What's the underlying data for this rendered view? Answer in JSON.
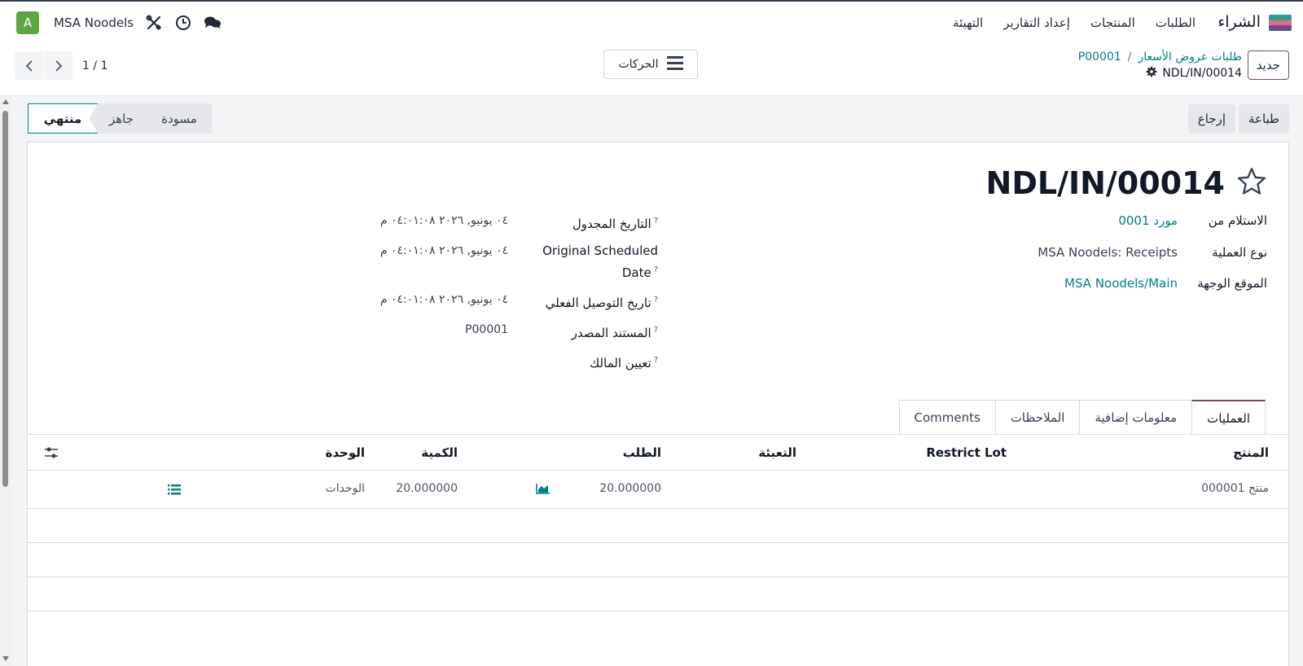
{
  "colors": {
    "accent": "#017e84",
    "brand": "#714b67",
    "avatar": "#5fa544"
  },
  "navbar": {
    "app_name": "الشراء",
    "menu": [
      "الطلبات",
      "المنتجات",
      "إعداد التقارير",
      "التهيئة"
    ],
    "company": "MSA Noodels",
    "avatar_letter": "A",
    "icons": [
      "chat-icon",
      "clock-icon",
      "tools-icon"
    ]
  },
  "control": {
    "new_label": "جديد",
    "breadcrumb": [
      "طلبات عروض الأسعار",
      "P00001"
    ],
    "breadcrumb_sep": "/",
    "record_name": "NDL/IN/00014",
    "actions_label": "الحركات",
    "pager": "1 / 1"
  },
  "buttons": {
    "print": "طباعة",
    "return": "إرجاع"
  },
  "statusbar": {
    "stages": [
      "مسودة",
      "جاهز",
      "منتهي"
    ],
    "active": "منتهي"
  },
  "form": {
    "title": "NDL/IN/00014",
    "right_fields": [
      {
        "label": "الاستلام من",
        "value": "مورد 0001"
      },
      {
        "label": "نوع العملية",
        "value": "MSA Noodels: Receipts"
      },
      {
        "label": "الموقع الوجهة",
        "value": "MSA Noodels/Main"
      }
    ],
    "left_fields": [
      {
        "label": "التاريخ المجدول",
        "value": "٠٤ يونيو, ٢٠٢٦ ٠٤:٠١:٠٨ م"
      },
      {
        "label": "Original Scheduled Date",
        "value": "٠٤ يونيو, ٢٠٢٦ ٠٤:٠١:٠٨ م"
      },
      {
        "label": "تاريخ التوصيل الفعلي",
        "value": "٠٤ يونيو, ٢٠٢٦ ٠٤:٠١:٠٨ م"
      },
      {
        "label": "المستند المصدر",
        "value": "P00001"
      },
      {
        "label": "تعيين المالك",
        "value": ""
      }
    ],
    "help_mark": "?"
  },
  "tabs": [
    "العمليات",
    "معلومات إضافية",
    "الملاحظات",
    "Comments"
  ],
  "table": {
    "columns": [
      "المنتج",
      "Restrict Lot",
      "التعبئة",
      "الطلب",
      "الكمية",
      "الوحدة"
    ],
    "rows": [
      {
        "product": "منتج 000001",
        "restrict_lot": "",
        "packaging": "",
        "demand": "20.000000",
        "quantity": "20.000000",
        "uom": "الوحدات"
      }
    ]
  }
}
